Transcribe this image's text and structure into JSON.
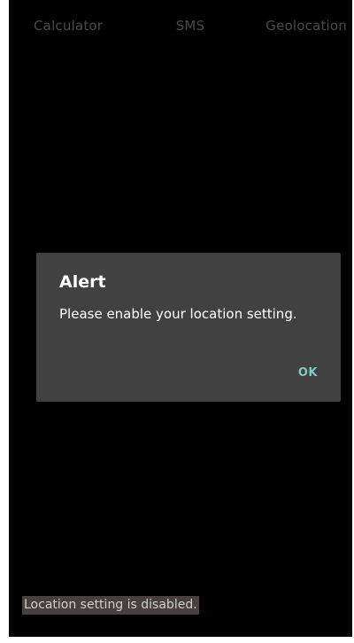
{
  "tabs": [
    {
      "label": "Calculator"
    },
    {
      "label": "SMS"
    },
    {
      "label": "Geolocation"
    }
  ],
  "dialog": {
    "title": "Alert",
    "message": "Please enable your location setting.",
    "ok_label": "OK"
  },
  "status": {
    "text": "Location setting is disabled."
  },
  "colors": {
    "background": "#000000",
    "dialog_bg": "#414141",
    "accent": "#80cbc4"
  }
}
